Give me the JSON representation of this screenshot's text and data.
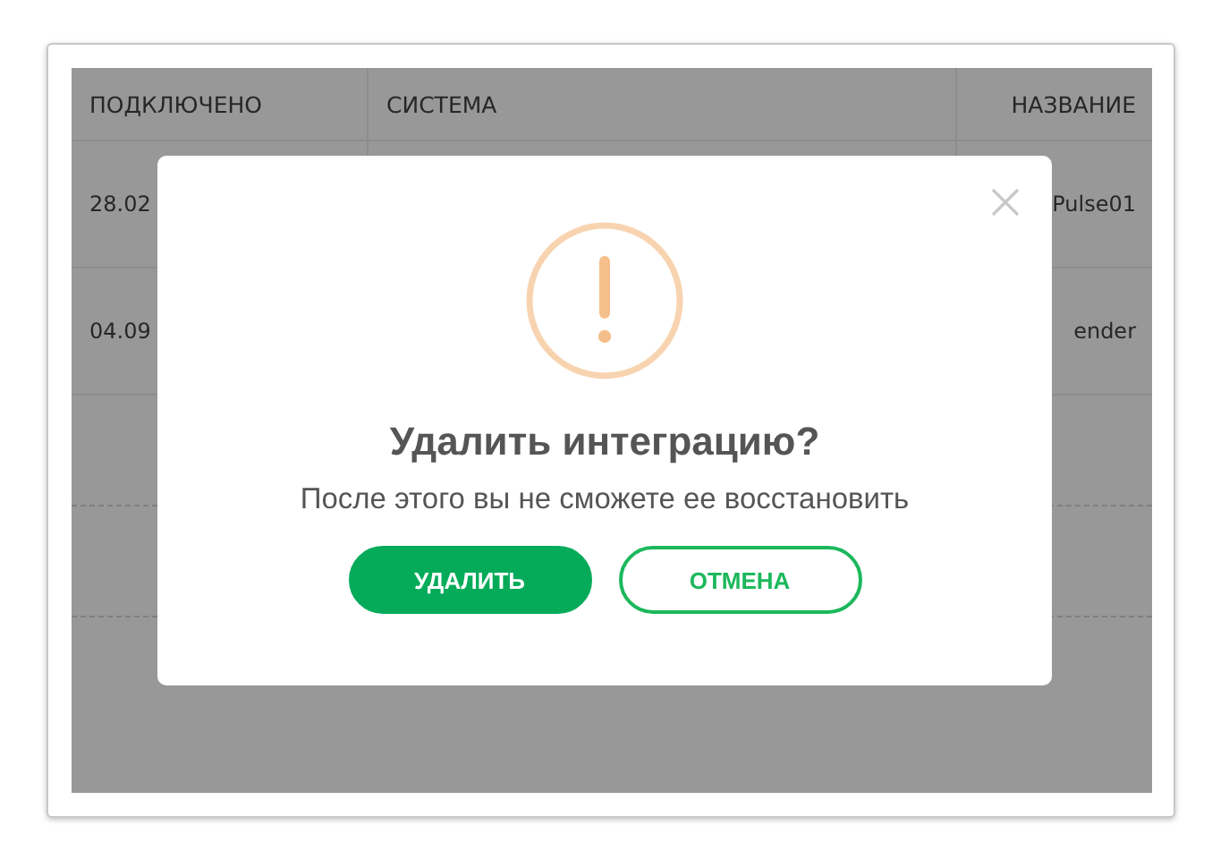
{
  "table": {
    "columns": [
      "ПОДКЛЮЧЕНО",
      "СИСТЕМА",
      "НАЗВАНИЕ"
    ],
    "rows": [
      {
        "connected": "28.02",
        "name": "Pulse01"
      },
      {
        "connected": "04.09",
        "name": "ender"
      }
    ]
  },
  "dialog": {
    "title": "Удалить интеграцию?",
    "message": "После этого вы не сможете ее восстановить",
    "buttons": [
      {
        "label": "УДАЛИТЬ",
        "kind": "primary"
      },
      {
        "label": "ОТМЕНА",
        "kind": "secondary"
      }
    ]
  }
}
